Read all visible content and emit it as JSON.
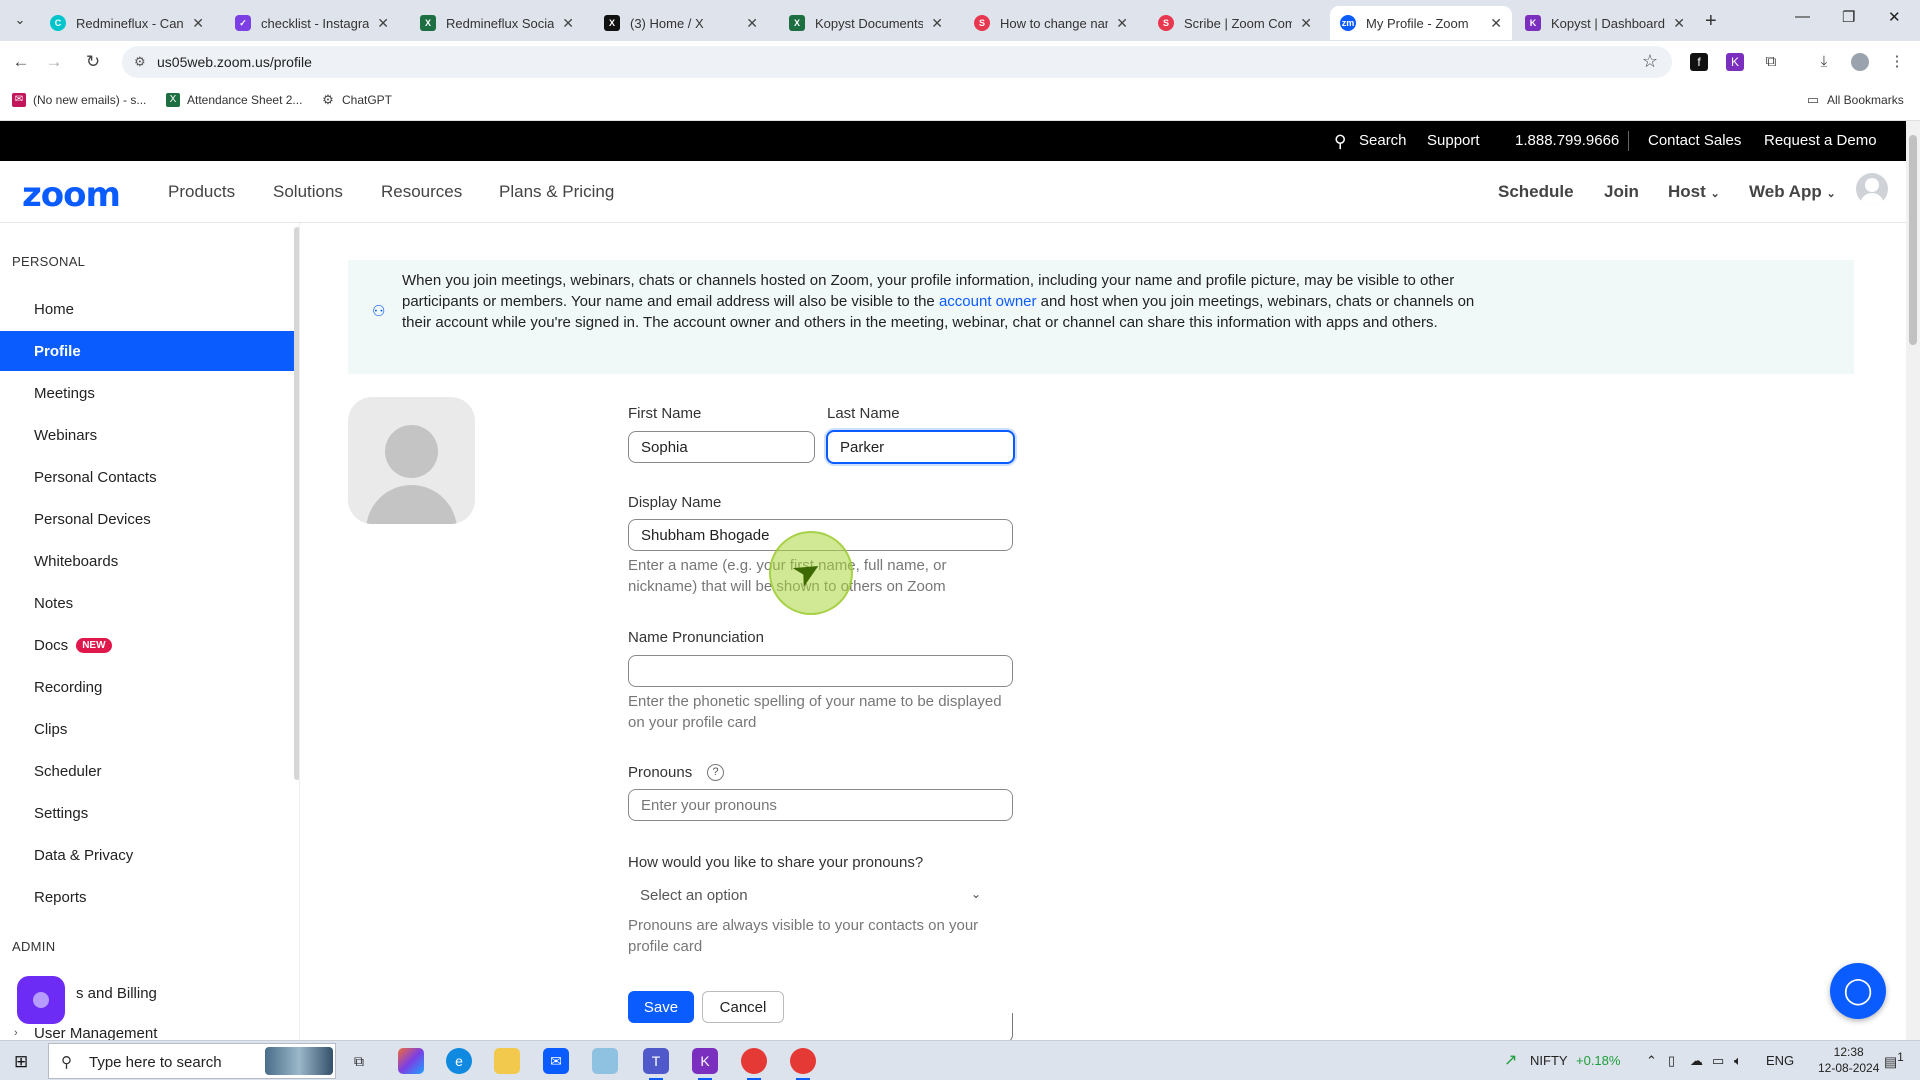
{
  "browser": {
    "tabs": [
      {
        "title": "Redmineflux - Canva",
        "icon": "canva-icon",
        "color": "#00c4cc"
      },
      {
        "title": "checklist - Instagram",
        "icon": "checklist-icon",
        "color": "#7b3fe4"
      },
      {
        "title": "Redmineflux Social M",
        "icon": "excel-icon",
        "color": "#1d6f42"
      },
      {
        "title": "(3) Home / X",
        "icon": "x-icon",
        "color": "#111111"
      },
      {
        "title": "Kopyst Documents Cr",
        "icon": "excel-icon",
        "color": "#1d6f42"
      },
      {
        "title": "How to change name",
        "icon": "scribe-icon",
        "color": "#e8384f"
      },
      {
        "title": "Scribe | Zoom Comm",
        "icon": "scribe-icon",
        "color": "#e8384f"
      },
      {
        "title": "My Profile - Zoom",
        "icon": "zoom-icon",
        "color": "#0b5cff"
      },
      {
        "title": "Kopyst | Dashboard",
        "icon": "kopyst-icon",
        "color": "#7b2fbe"
      }
    ],
    "url": "us05web.zoom.us/profile",
    "bookmarks": [
      {
        "label": "(No new emails) - s...",
        "icon": "mail-icon",
        "color": "#c2185b"
      },
      {
        "label": "Attendance Sheet 2...",
        "icon": "excel-icon",
        "color": "#1d6f42"
      },
      {
        "label": "ChatGPT",
        "icon": "chatgpt-icon",
        "color": "#444444"
      }
    ],
    "all_bookmarks": "All Bookmarks"
  },
  "zoom_topbar": {
    "search": "Search",
    "support": "Support",
    "phone": "1.888.799.9666",
    "contact_sales": "Contact Sales",
    "request_demo": "Request a Demo"
  },
  "zoom_nav": {
    "logo": "zoom",
    "menu": [
      "Products",
      "Solutions",
      "Resources",
      "Plans & Pricing"
    ],
    "schedule": "Schedule",
    "join": "Join",
    "host": "Host",
    "web_app": "Web App"
  },
  "sidebar": {
    "personal_heading": "PERSONAL",
    "items": [
      "Home",
      "Profile",
      "Meetings",
      "Webinars",
      "Personal Contacts",
      "Personal Devices",
      "Whiteboards",
      "Notes",
      "Docs",
      "Recording",
      "Clips",
      "Scheduler",
      "Settings",
      "Data & Privacy",
      "Reports"
    ],
    "active_item": "Profile",
    "docs_badge": "NEW",
    "admin_heading": "ADMIN",
    "admin_items": [
      "Account and Billing",
      "User Management"
    ],
    "admin_visible": [
      "s and Billing",
      "User Management"
    ]
  },
  "notice": {
    "text_before": "When you join meetings, webinars, chats or channels hosted on Zoom, your profile information, including your name and profile picture, may be visible to other participants or members. Your name and email address will also be visible to the ",
    "link": "account owner",
    "text_after": " and host when you join meetings, webinars, chats or channels on their account while you're signed in. The account owner and others in the meeting, webinar, chat or channel can share this information with apps and others."
  },
  "form": {
    "first_name_label": "First Name",
    "first_name": "Sophia",
    "last_name_label": "Last Name",
    "last_name": "Parker",
    "display_name_label": "Display Name",
    "display_name": "Shubham Bhogade",
    "display_name_hint": "Enter a name (e.g. your first name, full name, or nickname) that will be shown to others on Zoom",
    "pronunciation_label": "Name Pronunciation",
    "pronunciation": "",
    "pronunciation_hint": "Enter the phonetic spelling of your name to be displayed on your profile card",
    "pronouns_label": "Pronouns",
    "pronouns_placeholder": "Enter your pronouns",
    "share_label": "How would you like to share your pronouns?",
    "share_value": "Select an option",
    "share_hint": "Pronouns are always visible to your contacts on your profile card",
    "save": "Save",
    "cancel": "Cancel"
  },
  "taskbar": {
    "search_placeholder": "Type here to search",
    "nifty_label": "NIFTY",
    "nifty_change": "+0.18%",
    "lang": "ENG",
    "time": "12:38",
    "date": "12-08-2024",
    "notifications": "1"
  }
}
